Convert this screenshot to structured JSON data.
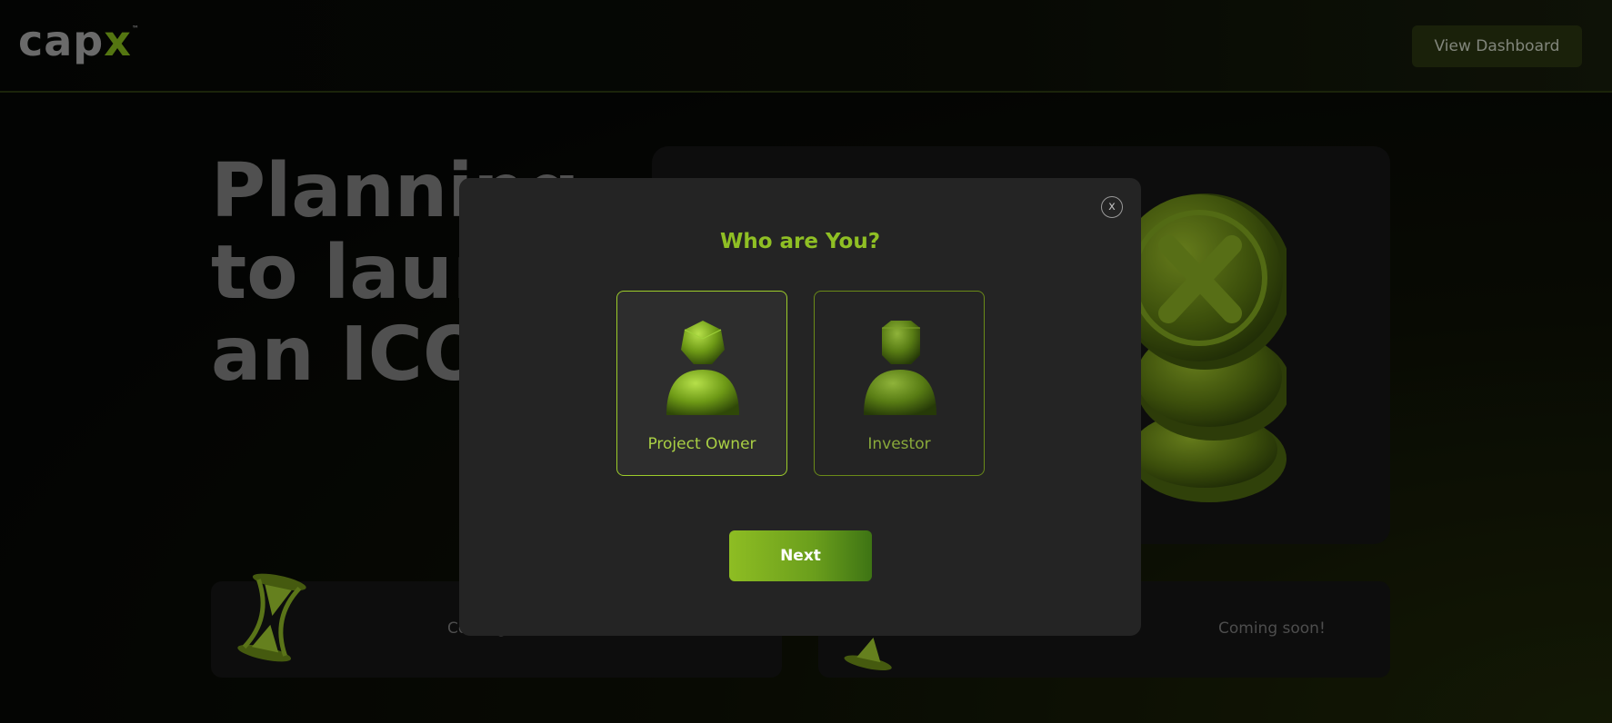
{
  "header": {
    "logo": {
      "prefix": "cap",
      "accent": "x",
      "trademark": "™"
    },
    "view_dashboard_label": "View Dashboard"
  },
  "hero": {
    "title_lines": [
      "Planning",
      "to launch",
      "an ICO?"
    ],
    "bottom_left_text": "Coming soon!",
    "bottom_right_text": "Coming soon!"
  },
  "modal": {
    "close_label": "x",
    "title": "Who are You?",
    "options": [
      {
        "label": "Project Owner",
        "selected": true,
        "icon": "project-owner-avatar-icon"
      },
      {
        "label": "Investor",
        "selected": false,
        "icon": "investor-avatar-icon"
      }
    ],
    "next_label": "Next"
  },
  "colors": {
    "accent": "#8fbf24",
    "modal_bg": "#242424",
    "button_dark_green": "#283410"
  }
}
